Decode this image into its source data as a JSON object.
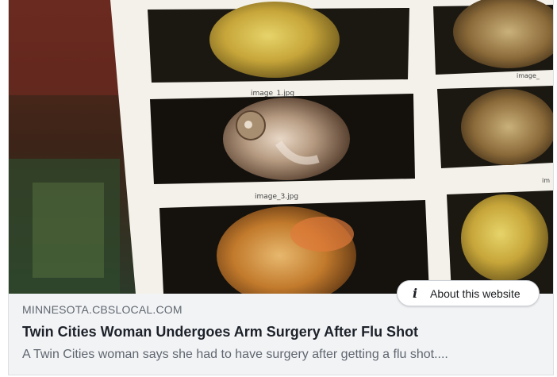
{
  "link_preview": {
    "image": {
      "alt": "",
      "labels": [
        "image_1.jpg",
        "image_3.jpg",
        "image_",
        "im"
      ]
    },
    "about_button": {
      "icon": "info-icon",
      "icon_glyph": "i",
      "label": "About this website"
    },
    "domain": "MINNESOTA.CBSLOCAL.COM",
    "title": "Twin Cities Woman Undergoes Arm Surgery After Flu Shot",
    "description": "A Twin Cities woman says she had to have surgery after getting a flu shot...."
  }
}
